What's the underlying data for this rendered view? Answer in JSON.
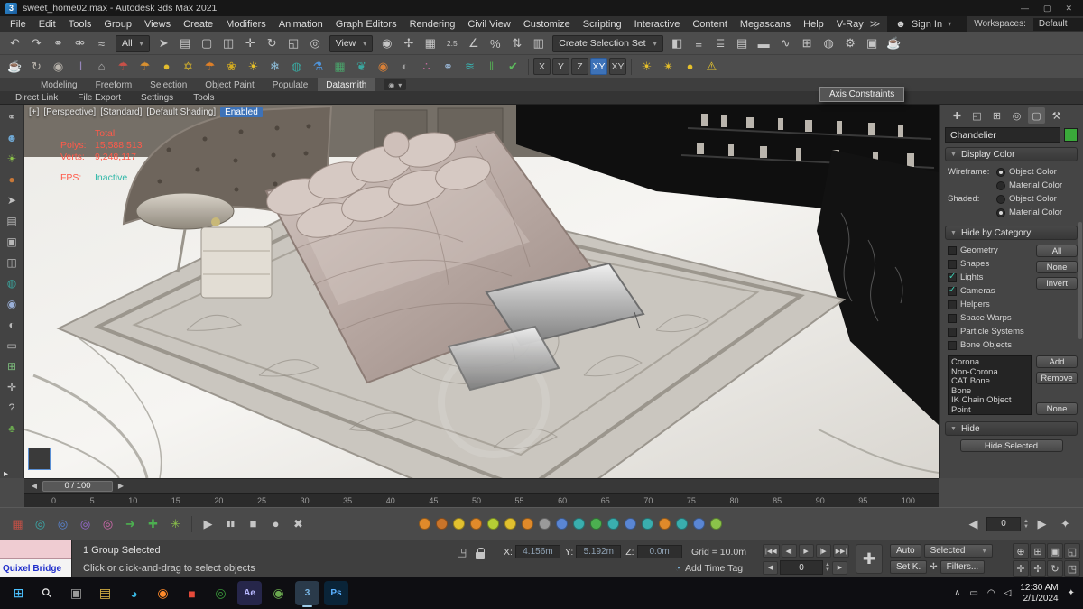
{
  "titlebar": {
    "app_glyph": "3",
    "title": "sweet_home02.max - Autodesk 3ds Max 2021",
    "controls": [
      {
        "name": "minimize-button",
        "glyph": "—"
      },
      {
        "name": "maximize-button",
        "glyph": "▢"
      },
      {
        "name": "close-button",
        "glyph": "✕"
      }
    ]
  },
  "menubar": {
    "items": [
      "File",
      "Edit",
      "Tools",
      "Group",
      "Views",
      "Create",
      "Modifiers",
      "Animation",
      "Graph Editors",
      "Rendering",
      "Civil View",
      "Customize",
      "Scripting",
      "Interactive",
      "Content",
      "Megascans",
      "Help",
      "V-Ray"
    ],
    "overflow_glyph": "≫",
    "signin_label": "Sign In",
    "workspaces_label": "Workspaces:",
    "workspace_value": "Default"
  },
  "toolbar1": {
    "icons_a": [
      {
        "name": "undo-icon",
        "glyph": "↶"
      },
      {
        "name": "redo-icon",
        "glyph": "↷"
      },
      {
        "name": "select-and-link-icon",
        "glyph": "⚭"
      },
      {
        "name": "unlink-selection-icon",
        "glyph": "⚮"
      },
      {
        "name": "bind-to-space-warp-icon",
        "glyph": "≈"
      }
    ],
    "filter_value": "All",
    "icons_b": [
      {
        "name": "select-object-icon",
        "glyph": "➤"
      },
      {
        "name": "select-by-name-icon",
        "glyph": "▤"
      },
      {
        "name": "rectangular-selection-icon",
        "glyph": "▢"
      },
      {
        "name": "window-crossing-icon",
        "glyph": "◫"
      },
      {
        "name": "select-and-move-icon",
        "glyph": "✛"
      },
      {
        "name": "select-and-rotate-icon",
        "glyph": "↻"
      },
      {
        "name": "select-and-scale-icon",
        "glyph": "◱"
      },
      {
        "name": "select-and-place-icon",
        "glyph": "◎"
      }
    ],
    "coord_value": "View",
    "icons_c": [
      {
        "name": "use-pivot-center-icon",
        "glyph": "◉"
      },
      {
        "name": "select-and-manipulate-icon",
        "glyph": "✢"
      },
      {
        "name": "keyboard-override-icon",
        "glyph": "▦"
      },
      {
        "name": "snaps-toggle-icon",
        "glyph": "2.5",
        "cls": "sm"
      },
      {
        "name": "angle-snap-icon",
        "glyph": "∠"
      },
      {
        "name": "percent-snap-icon",
        "glyph": "%"
      },
      {
        "name": "spinner-snap-icon",
        "glyph": "⇅"
      },
      {
        "name": "edit-named-sets-icon",
        "glyph": "▥"
      }
    ],
    "sets_value": "Create Selection Set",
    "icons_d": [
      {
        "name": "mirror-icon",
        "glyph": "◧"
      },
      {
        "name": "align-icon",
        "glyph": "≡"
      },
      {
        "name": "scene-explorer-icon",
        "glyph": "≣"
      },
      {
        "name": "layer-explorer-icon",
        "glyph": "▤"
      },
      {
        "name": "ribbon-toggle-icon",
        "glyph": "▬"
      },
      {
        "name": "curve-editor-icon",
        "glyph": "∿"
      },
      {
        "name": "schematic-view-icon",
        "glyph": "⊞"
      },
      {
        "name": "material-editor-icon",
        "glyph": "◍"
      },
      {
        "name": "render-setup-icon",
        "glyph": "⚙"
      },
      {
        "name": "rendered-frame-icon",
        "glyph": "▣"
      },
      {
        "name": "render-production-icon",
        "glyph": "☕"
      }
    ]
  },
  "toolbar2": {
    "icons": [
      {
        "name": "corona-render-icon",
        "glyph": "☕",
        "color": "#b9b4ac"
      },
      {
        "name": "corona-interactive-icon",
        "glyph": "↻",
        "color": "#b9b4ac"
      },
      {
        "name": "corona-camera-icon",
        "glyph": "◉",
        "color": "#b9b4ac"
      },
      {
        "name": "corona-columns-icon",
        "glyph": "‖",
        "color": "#9a8ac0"
      },
      {
        "name": "corona-proxy-icon",
        "glyph": "⌂",
        "color": "#b0b0b0"
      },
      {
        "name": "light-red-icon",
        "glyph": "☂",
        "color": "#c85048"
      },
      {
        "name": "light-amber-icon",
        "glyph": "☂",
        "color": "#d89030"
      },
      {
        "name": "sphere-yellow-icon",
        "glyph": "●",
        "color": "#e2bc2e"
      },
      {
        "name": "star-icon",
        "glyph": "✡",
        "color": "#d8b42a"
      },
      {
        "name": "umbrella-orange-icon",
        "glyph": "☂",
        "color": "#dd7f28"
      },
      {
        "name": "flower-icon",
        "glyph": "❀",
        "color": "#d4ac20"
      },
      {
        "name": "sun-icon",
        "glyph": "☀",
        "color": "#e6c02a"
      },
      {
        "name": "snowflake-icon",
        "glyph": "❄",
        "color": "#8fc0dd"
      },
      {
        "name": "globe-teal-icon",
        "glyph": "◍",
        "color": "#3aa79f"
      },
      {
        "name": "flask-blue-icon",
        "glyph": "⚗",
        "color": "#4f93d8"
      },
      {
        "name": "grid-green-icon",
        "glyph": "▦",
        "color": "#4aa06a"
      },
      {
        "name": "leaf-teal-icon",
        "glyph": "❦",
        "color": "#3aa79f"
      },
      {
        "name": "drop-orange-icon",
        "glyph": "◉",
        "color": "#d88038"
      },
      {
        "name": "sphere-gray-icon",
        "glyph": "◐",
        "color": "#a0a0a0"
      },
      {
        "name": "dots-color-icon",
        "glyph": "∴",
        "color": "#c06a9a"
      },
      {
        "name": "rings-icon",
        "glyph": "⚭",
        "color": "#9ab8d8"
      },
      {
        "name": "spray-teal-icon",
        "glyph": "≋",
        "color": "#3ab0ae"
      },
      {
        "name": "bars-green-icon",
        "glyph": "‖",
        "color": "#54a054"
      },
      {
        "name": "check-green-icon",
        "glyph": "✔",
        "color": "#5cb85c"
      }
    ],
    "axis": [
      {
        "label": "X",
        "name": "axis-x-button"
      },
      {
        "label": "Y",
        "name": "axis-y-button"
      },
      {
        "label": "Z",
        "name": "axis-z-button"
      },
      {
        "label": "XY",
        "name": "axis-xy-button",
        "active": true
      },
      {
        "label": "XY",
        "name": "axis-plane-button"
      }
    ],
    "tail": [
      {
        "name": "light-sun-icon",
        "glyph": "☀",
        "color": "#e6c02a"
      },
      {
        "name": "light-spot-icon",
        "glyph": "✴",
        "color": "#e6c02a"
      },
      {
        "name": "light-bulb-icon",
        "glyph": "●",
        "color": "#e6c02a"
      },
      {
        "name": "warning-icon",
        "glyph": "⚠",
        "color": "#e2c22e"
      }
    ]
  },
  "ribbon": {
    "tabs": [
      {
        "label": "Modeling"
      },
      {
        "label": "Freeform"
      },
      {
        "label": "Selection"
      },
      {
        "label": "Object Paint"
      },
      {
        "label": "Populate"
      },
      {
        "label": "Datasmith",
        "active": true
      }
    ],
    "extra": [
      {
        "name": "ribbon-pin-icon",
        "glyph": "◉"
      },
      {
        "name": "ribbon-collapse-icon",
        "glyph": "▾"
      }
    ],
    "subitems": [
      {
        "label": "Direct Link"
      },
      {
        "label": "File Export"
      },
      {
        "label": "Settings"
      },
      {
        "label": "Tools"
      }
    ]
  },
  "tooltip": {
    "text": "Axis Constraints"
  },
  "left_toolbar": {
    "icons": [
      {
        "name": "link-tool-icon",
        "glyph": "⚭",
        "color": "#b8b8b8"
      },
      {
        "name": "populate-icon",
        "glyph": "☻",
        "color": "#6fa8d4"
      },
      {
        "name": "light-lister-icon",
        "glyph": "☀",
        "color": "#8bc34a"
      },
      {
        "name": "sphere-tool-icon",
        "glyph": "●",
        "color": "#c87838"
      },
      {
        "name": "pointer-icon",
        "glyph": "➤",
        "color": "#c0c0c0"
      },
      {
        "name": "notes-icon",
        "glyph": "▤",
        "color": "#b8b8b8"
      },
      {
        "name": "box-tool-icon",
        "glyph": "▣",
        "color": "#b8b8b8"
      },
      {
        "name": "arch-tool-icon",
        "glyph": "◫",
        "color": "#b8b8b8"
      },
      {
        "name": "globe-tool-icon",
        "glyph": "◍",
        "color": "#3aa79f"
      },
      {
        "name": "camera-tool-icon",
        "glyph": "◉",
        "color": "#9ab0d8"
      },
      {
        "name": "render-small-icon",
        "glyph": "◐",
        "color": "#b8b8b8"
      },
      {
        "name": "monitor-icon",
        "glyph": "▭",
        "color": "#b8b8b8"
      },
      {
        "name": "grid-add-icon",
        "glyph": "⊞",
        "color": "#7ab87a"
      },
      {
        "name": "hand-tool-icon",
        "glyph": "✛",
        "color": "#c0c0c0"
      },
      {
        "name": "question-icon",
        "glyph": "?",
        "color": "#c0c0c0"
      },
      {
        "name": "tree-tool-icon",
        "glyph": "♣",
        "color": "#6aa84f"
      }
    ],
    "expander_glyph": "▸"
  },
  "viewport": {
    "label": [
      {
        "text": "[+]",
        "name": "viewport-menu-general"
      },
      {
        "text": "[Perspective]",
        "name": "viewport-menu-pov"
      },
      {
        "text": "[Standard]",
        "name": "viewport-menu-standard"
      },
      {
        "text": "[Default Shading]",
        "name": "viewport-menu-shading"
      }
    ],
    "label_chip": "Enabled",
    "stats": {
      "rows": [
        {
          "label": "",
          "value": "Total"
        },
        {
          "label": "Polys:",
          "value": "15,588,513"
        },
        {
          "label": "Verts:",
          "value": "9,248,117"
        },
        {
          "label": "FPS:",
          "value": "Inactive",
          "cls": "teal gap"
        }
      ]
    }
  },
  "command_panel": {
    "tabs": [
      {
        "name": "create-tab",
        "glyph": "✚"
      },
      {
        "name": "modify-tab",
        "glyph": "◱"
      },
      {
        "name": "hierarchy-tab",
        "glyph": "⊞"
      },
      {
        "name": "motion-tab",
        "glyph": "◎"
      },
      {
        "name": "display-tab",
        "glyph": "▢",
        "active": true
      },
      {
        "name": "utilities-tab",
        "glyph": "⚒"
      }
    ],
    "object_name": "Chandelier",
    "object_color": "#3aa93a",
    "display_color": {
      "title": "Display Color",
      "radios": [
        {
          "group": "Wireframe:",
          "label": "Object Color",
          "active": true
        },
        {
          "group": "",
          "label": "Material Color"
        },
        {
          "group": "Shaded:",
          "label": "Object Color"
        },
        {
          "group": "",
          "label": "Material Color",
          "active": true
        }
      ]
    },
    "hide_by_category": {
      "title": "Hide by Category",
      "checkboxes": [
        {
          "label": "Geometry"
        },
        {
          "label": "Shapes"
        },
        {
          "label": "Lights",
          "active": true
        },
        {
          "label": "Cameras",
          "active": true
        },
        {
          "label": "Helpers"
        },
        {
          "label": "Space Warps"
        },
        {
          "label": "Particle Systems"
        },
        {
          "label": "Bone Objects"
        }
      ],
      "buttons": [
        {
          "label": "All",
          "name": "hide-category-all-button"
        },
        {
          "label": "None",
          "name": "hide-category-none-button"
        },
        {
          "label": "Invert",
          "name": "hide-category-invert-button"
        }
      ],
      "list": [
        "Corona",
        "Non-Corona",
        "CAT Bone",
        "Bone",
        "IK Chain Object",
        "Point"
      ],
      "list_buttons_top": [
        {
          "label": "Add",
          "name": "category-add-button"
        },
        {
          "label": "Remove",
          "name": "category-remove-button"
        }
      ],
      "list_button_bottom": {
        "label": "None",
        "name": "category-list-none-button"
      }
    },
    "hide": {
      "title": "Hide",
      "button": "Hide Selected"
    }
  },
  "timeline": {
    "slider_label": "0 / 100",
    "prev_glyph": "◀",
    "next_glyph": "▶",
    "ticks": [
      "0",
      "5",
      "10",
      "15",
      "20",
      "25",
      "30",
      "35",
      "40",
      "45",
      "50",
      "55",
      "60",
      "65",
      "70",
      "75",
      "80",
      "85",
      "90",
      "95",
      "100"
    ]
  },
  "track_toolbar": {
    "left_icons": [
      {
        "name": "mini-curve-editor-icon",
        "glyph": "▦",
        "color": "#c05046"
      },
      {
        "name": "ring-teal-icon",
        "glyph": "◎",
        "color": "#3aaeae"
      },
      {
        "name": "ring-blue-icon",
        "glyph": "◎",
        "color": "#5a86d4"
      },
      {
        "name": "ring-purple-icon",
        "glyph": "◎",
        "color": "#9a6ad4"
      },
      {
        "name": "ring-pink-icon",
        "glyph": "◎",
        "color": "#d46ab0"
      },
      {
        "name": "link-green-icon",
        "glyph": "➜",
        "color": "#4caf50"
      },
      {
        "name": "add-green-icon",
        "glyph": "✚",
        "color": "#4caf50"
      },
      {
        "name": "burst-green-icon",
        "glyph": "✳",
        "color": "#8bc34a"
      }
    ],
    "playback": [
      {
        "name": "play-button",
        "glyph": "▶"
      },
      {
        "name": "pause-button",
        "glyph": "▮▮",
        "cls": "sm"
      },
      {
        "name": "stop-button",
        "glyph": "■"
      },
      {
        "name": "record-button",
        "glyph": "●"
      },
      {
        "name": "delete-key-button",
        "glyph": "✖"
      }
    ],
    "key_dots": [
      "#e08a2a",
      "#c9742a",
      "#e2c12f",
      "#e08a2a",
      "#b5cf35",
      "#e2c12f",
      "#e08a2a",
      "#9a9a9a",
      "#5a86d4",
      "#3aaeae",
      "#4caf50",
      "#3aaeae",
      "#5a86d4",
      "#3aaeae",
      "#e08a2a",
      "#3aaeae",
      "#5a86d4",
      "#8bc34a"
    ],
    "prev_glyph": "◀",
    "next_glyph": "▶",
    "frame_value": "0",
    "key_glyph": "✦"
  },
  "status_bar": {
    "listener_link": "Quixel Bridge",
    "line1": "1 Group Selected",
    "prompt": "Click or click-and-drag to select objects",
    "isolate_glyph": "◳",
    "coords": [
      {
        "label": "X:",
        "value": "4.156m"
      },
      {
        "label": "Y:",
        "value": "5.192m"
      },
      {
        "label": "Z:",
        "value": "0.0m"
      }
    ],
    "grid": "Grid = 10.0m",
    "time_tag": "Add Time Tag",
    "time_tag_glyph": "◔",
    "transport": [
      {
        "name": "go-to-start-button",
        "glyph": "|◀◀"
      },
      {
        "name": "previous-frame-button",
        "glyph": "◀|"
      },
      {
        "name": "play-animation-button",
        "glyph": "▶"
      },
      {
        "name": "next-frame-button",
        "glyph": "|▶"
      },
      {
        "name": "go-to-end-button",
        "glyph": "▶▶|"
      }
    ],
    "frame_value": "0",
    "bigkey_glyph": "✚",
    "auto_label": "Auto",
    "selected_label": "Selected",
    "setk_label": "Set K.",
    "paw_glyph": "✢",
    "filters_label": "Filters...",
    "nav": [
      {
        "name": "zoom-icon",
        "glyph": "⊕"
      },
      {
        "name": "zoom-all-icon",
        "glyph": "⊞"
      },
      {
        "name": "zoom-extents-icon",
        "glyph": "▣"
      },
      {
        "name": "zoom-region-icon",
        "glyph": "◱"
      },
      {
        "name": "pan-icon",
        "glyph": "✛"
      },
      {
        "name": "walk-through-icon",
        "glyph": "✢"
      },
      {
        "name": "orbit-icon",
        "glyph": "↻"
      },
      {
        "name": "maximize-viewport-icon",
        "glyph": "◳"
      }
    ]
  },
  "taskbar": {
    "apps": [
      {
        "name": "start-button",
        "glyph": "⊞",
        "color": "#4cc2ff"
      },
      {
        "name": "search-button",
        "glyph": "⚲",
        "color": "#e8e8e8",
        "cls": "rot"
      },
      {
        "name": "task-view-button",
        "glyph": "▣",
        "color": "#9a9a9a"
      },
      {
        "name": "file-explorer-button",
        "glyph": "▤",
        "color": "#e8c048"
      },
      {
        "name": "edge-button",
        "glyph": "◕",
        "color": "#38b6e0"
      },
      {
        "name": "firefox-button",
        "glyph": "◉",
        "color": "#ff8a2a"
      },
      {
        "name": "adobe-button",
        "glyph": "■",
        "color": "#e64a3a"
      },
      {
        "name": "xbox-button",
        "glyph": "◎",
        "color": "#3a9a3a"
      },
      {
        "name": "after-effects-button",
        "glyph": "Ae",
        "color": "#b8b8ff",
        "bg": "#26264a",
        "cls": "txt"
      },
      {
        "name": "chrome-button",
        "glyph": "◉",
        "color": "#6aa84f"
      },
      {
        "name": "3ds-max-button",
        "glyph": "3",
        "color": "#7ab8e8",
        "bg": "#2a3a4a",
        "active": true,
        "cls": "txt"
      },
      {
        "name": "photoshop-button",
        "glyph": "Ps",
        "color": "#5ab0ff",
        "bg": "#0a2438",
        "cls": "txt"
      }
    ],
    "tray": [
      {
        "name": "hidden-icons-button",
        "glyph": "∧"
      },
      {
        "name": "onedrive-icon",
        "glyph": "▭"
      },
      {
        "name": "network-icon",
        "glyph": "◠"
      },
      {
        "name": "volume-icon",
        "glyph": "◁"
      }
    ],
    "time": "12:30 AM",
    "date": "2/1/2024",
    "bell_glyph": "✦"
  }
}
